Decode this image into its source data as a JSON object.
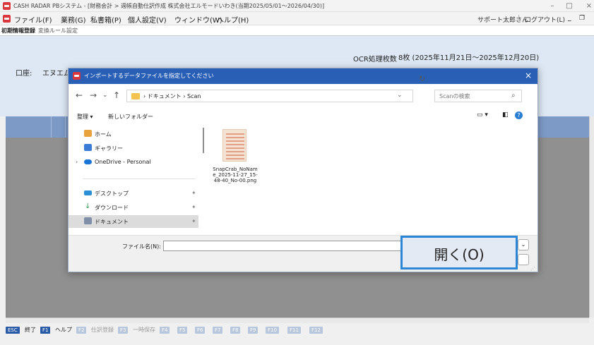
{
  "window": {
    "title": "CASH RADAR PBシステム - [財務会計 > 週帳自動仕訳作成 株式会社エルモードいわき(当期2025/05/01〜2026/04/30)]",
    "min_icon": "minimize-icon",
    "max_icon": "maximize-icon",
    "close_icon": "close-icon"
  },
  "menubar": {
    "items": [
      "ファイル(F)",
      "業務(G)",
      "私書箱(P)",
      "個人設定(V)",
      "ウィンドウ(W)",
      "ヘルプ(H)"
    ],
    "user": "サポート太郎さん",
    "separator": "|",
    "logout": "ログアウト(L)"
  },
  "breadcrumb": {
    "items": [
      "初期情報登録",
      "変換ルール設定"
    ]
  },
  "info": {
    "ocr_label": "OCR処理枚数",
    "ocr_value": "8枚 (2025年11月21日〜2025年12月20日)",
    "account_label": "口座:",
    "account_value": "エヌエム"
  },
  "fkeys": [
    {
      "key": "ESC",
      "label": "終了",
      "active": true
    },
    {
      "key": "F1",
      "label": "ヘルプ",
      "active": true
    },
    {
      "key": "F2",
      "label": "仕訳登録",
      "active": false
    },
    {
      "key": "F3",
      "label": "一時保存",
      "active": false
    },
    {
      "key": "F4",
      "label": "",
      "active": false
    },
    {
      "key": "F5",
      "label": "",
      "active": false
    },
    {
      "key": "F6",
      "label": "",
      "active": false
    },
    {
      "key": "F7",
      "label": "",
      "active": false
    },
    {
      "key": "F8",
      "label": "",
      "active": false
    },
    {
      "key": "F9",
      "label": "",
      "active": false
    },
    {
      "key": "F10",
      "label": "",
      "active": false
    },
    {
      "key": "F11",
      "label": "",
      "active": false
    },
    {
      "key": "F12",
      "label": "",
      "active": false
    }
  ],
  "dialog": {
    "title": "インポートするデータファイルを指定してください",
    "path": "› ドキュメント › Scan",
    "search_placeholder": "Scanの検索",
    "toolbar": {
      "organize": "整理 ▾",
      "new_folder": "新しいフォルダー"
    },
    "nav": [
      {
        "label": "ホーム",
        "icon": "home-icon",
        "color": "#e8a33c"
      },
      {
        "label": "ギャラリー",
        "icon": "gallery-icon",
        "color": "#3a7bd5"
      },
      {
        "label": "OneDrive - Personal",
        "icon": "onedrive-icon",
        "color": "#1b74d8"
      },
      {
        "label": "デスクトップ",
        "icon": "desktop-icon",
        "color": "#2b8fd6"
      },
      {
        "label": "ダウンロード",
        "icon": "download-icon",
        "color": "#2f9a55"
      },
      {
        "label": "ドキュメント",
        "icon": "documents-icon",
        "color": "#7f8fa8"
      }
    ],
    "file": {
      "name": "SnapCrab_NoName_2025-11-27_15-48-40_No-00.png"
    },
    "filename_label": "ファイル名(N):",
    "filename_value": "",
    "open_button": "開く(O)"
  }
}
